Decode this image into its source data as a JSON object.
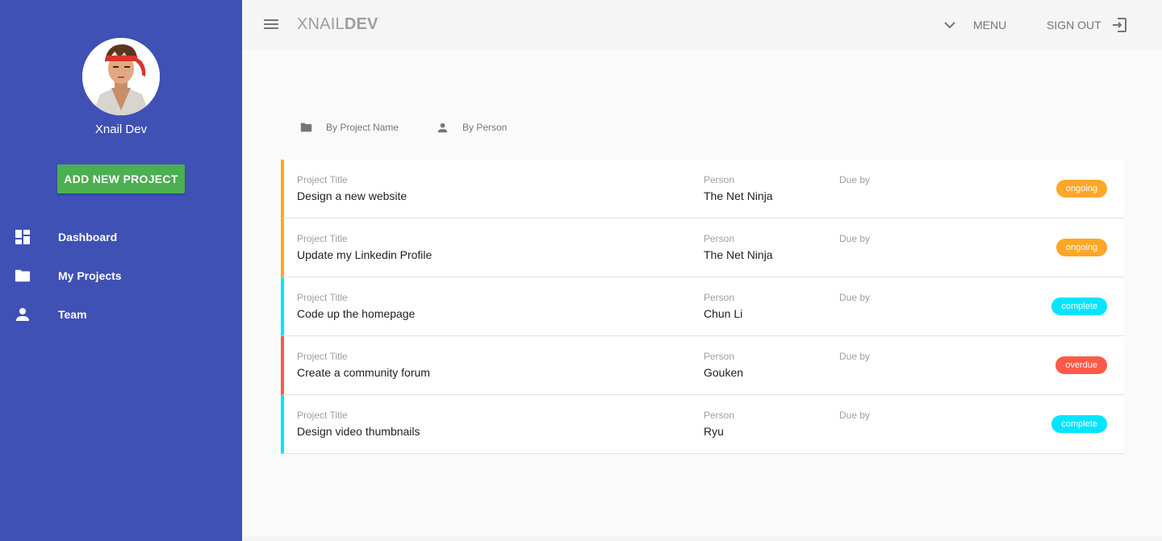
{
  "sidebar": {
    "user_name": "Xnail Dev",
    "add_button_label": "ADD NEW PROJECT",
    "items": [
      {
        "label": "Dashboard",
        "icon": "dashboard-icon"
      },
      {
        "label": "My Projects",
        "icon": "folder-icon"
      },
      {
        "label": "Team",
        "icon": "person-icon"
      }
    ]
  },
  "toolbar": {
    "brand_thin": "XNAIL",
    "brand_bold": "DEV",
    "menu_label": "MENU",
    "signout_label": "SIGN OUT"
  },
  "sort": {
    "by_project": "By Project Name",
    "by_person": "By Person"
  },
  "columns": {
    "title": "Project Title",
    "person": "Person",
    "due": "Due by"
  },
  "projects": [
    {
      "title": "Design a new website",
      "person": "The Net Ninja",
      "due": "",
      "status": "ongoing"
    },
    {
      "title": "Update my Linkedin Profile",
      "person": "The Net Ninja",
      "due": "",
      "status": "ongoing"
    },
    {
      "title": "Code up the homepage",
      "person": "Chun Li",
      "due": "",
      "status": "complete"
    },
    {
      "title": "Create a community forum",
      "person": "Gouken",
      "due": "",
      "status": "overdue"
    },
    {
      "title": "Design video thumbnails",
      "person": "Ryu",
      "due": "",
      "status": "complete"
    }
  ],
  "colors": {
    "sidebar": "#3f51b5",
    "add_button": "#4caf50",
    "ongoing": "#ffa726",
    "complete": "#00e5ff",
    "overdue": "#ff5a48"
  }
}
